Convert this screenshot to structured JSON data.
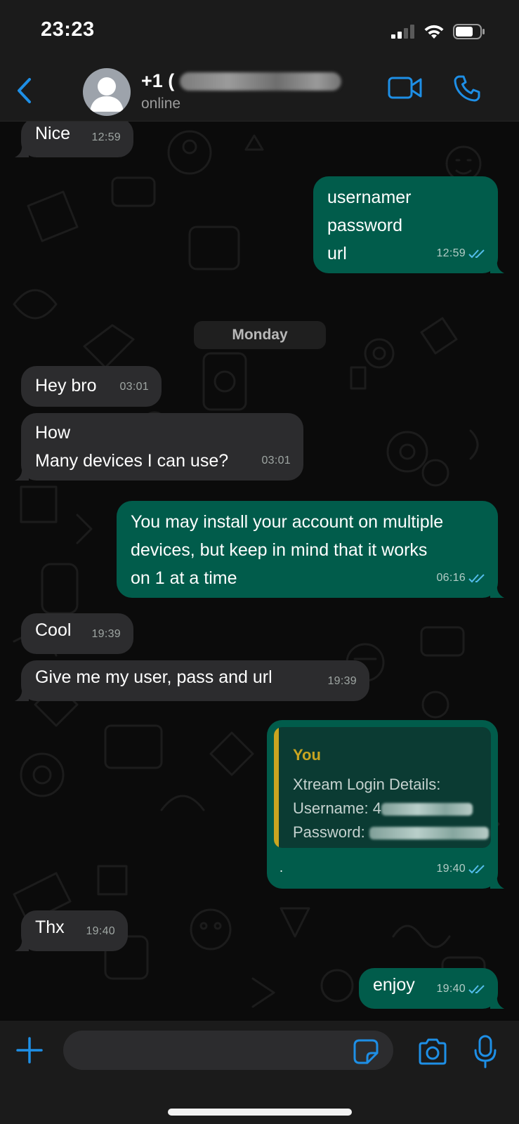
{
  "status_bar": {
    "time": "23:23",
    "icons": [
      "cellular-signal-icon",
      "wifi-icon",
      "battery-icon"
    ]
  },
  "header": {
    "contact_name": "+1 (",
    "contact_status": "online",
    "icons": [
      "back-chevron-icon",
      "avatar-person-icon",
      "video-camera-icon",
      "phone-icon"
    ]
  },
  "messages": [
    {
      "direction": "in",
      "text": "Nice",
      "time": "12:59"
    },
    {
      "direction": "out",
      "text": "usernamer\npassword\nurl",
      "time": "12:59",
      "read": true
    },
    {
      "direction": "in",
      "text": "Hey bro",
      "time": "03:01"
    },
    {
      "direction": "in",
      "text": "How\nMany devices I can use?",
      "time": "03:01"
    },
    {
      "direction": "out",
      "text": "You may install your account on multiple\ndevices, but keep in mind that it works\non 1 at a time",
      "time": "06:16",
      "read": true
    },
    {
      "direction": "in",
      "text": "Cool",
      "time": "19:39"
    },
    {
      "direction": "in",
      "text": "Give me my user, pass and url",
      "time": "19:39"
    },
    {
      "direction": "out",
      "text": ".",
      "time": "19:40",
      "read": true,
      "quote": {
        "author": "You",
        "title": "Xtream Login Details:",
        "username_label": "Username: 4",
        "password_label": "Password: "
      }
    },
    {
      "direction": "in",
      "text": "Thx",
      "time": "19:40"
    },
    {
      "direction": "out",
      "text": "enjoy",
      "time": "19:40",
      "read": true
    }
  ],
  "date_separator": "Monday",
  "input_bar": {
    "placeholder": "",
    "icons": [
      "plus-icon",
      "sticker-icon",
      "camera-icon",
      "microphone-icon"
    ]
  },
  "colors": {
    "accent": "#1e8fe6",
    "outgoing_bubble": "#015c4b",
    "incoming_bubble": "#2c2c2e",
    "read_tick": "#53bdeb",
    "quote_author": "#c9a520"
  }
}
